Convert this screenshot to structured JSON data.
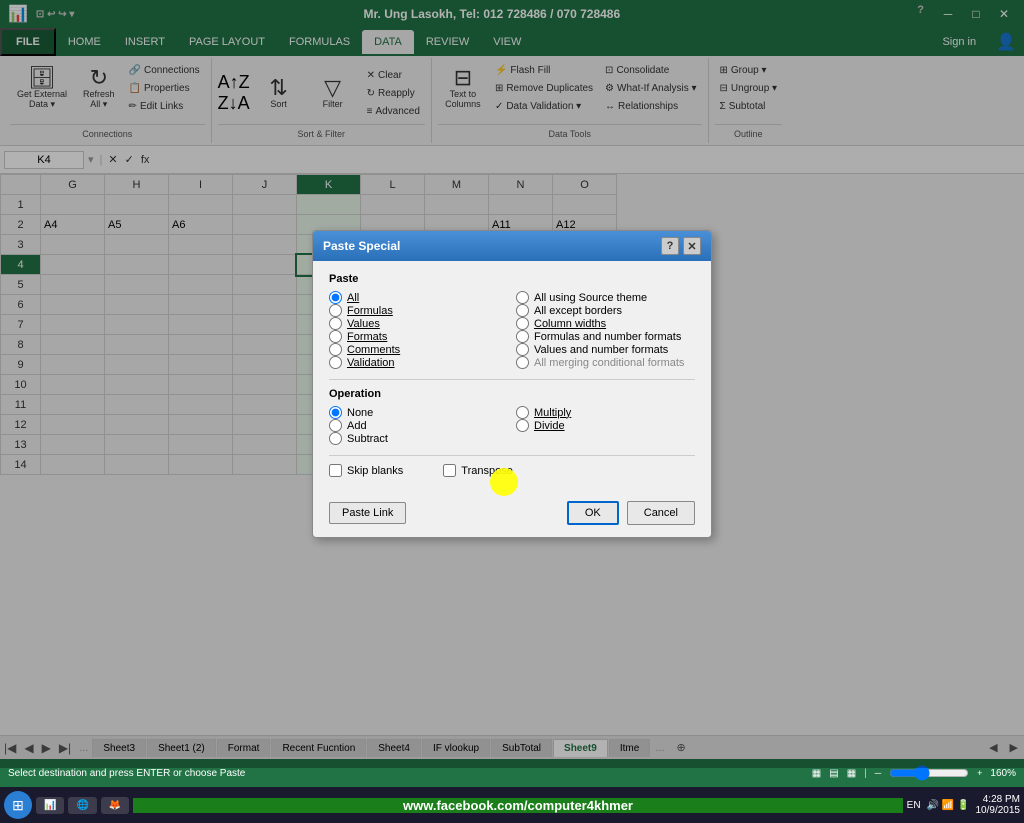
{
  "titleBar": {
    "title": "Mr. Ung Lasokh, Tel: 012 728486 / 070 728486",
    "controls": [
      "?",
      "─",
      "□",
      "✕"
    ]
  },
  "ribbon": {
    "tabs": [
      "FILE",
      "HOME",
      "INSERT",
      "PAGE LAYOUT",
      "FORMULAS",
      "DATA",
      "REVIEW",
      "VIEW"
    ],
    "activeTab": "DATA",
    "signIn": "Sign in",
    "groups": {
      "connections": {
        "label": "Connections",
        "buttons": [
          {
            "icon": "⬇",
            "label": "Get External\nData ▾"
          },
          {
            "icon": "↻",
            "label": "Refresh\nAll ▾"
          }
        ],
        "smallButtons": [
          {
            "icon": "🔗",
            "label": "Connections"
          },
          {
            "icon": "📋",
            "label": "Properties"
          },
          {
            "icon": "✏️",
            "label": "Edit Links"
          }
        ]
      },
      "sortFilter": {
        "label": "Sort & Filter",
        "sortAZ": "A→Z",
        "sortZA": "Z→A",
        "sortLabel": "Sort",
        "filterLabel": "Filter",
        "clearLabel": "Clear",
        "reapplyLabel": "Reapply",
        "advancedLabel": "Advanced"
      },
      "dataTools": {
        "label": "Data Tools",
        "textToColumns": "Text to\nColumns",
        "flashFill": "Flash Fill",
        "removeDuplicates": "Remove Duplicates",
        "dataValidation": "Data Validation ▾",
        "whatIfAnalysis": "What-If Analysis ▾",
        "relationships": "Relationships",
        "consolidate": "Consolidate"
      },
      "outline": {
        "label": "Outline",
        "group": "Group ▾",
        "ungroup": "Ungroup ▾",
        "subtotal": "Subtotal"
      }
    }
  },
  "formulaBar": {
    "nameBox": "K4",
    "formula": ""
  },
  "columns": [
    "",
    "G",
    "H",
    "I",
    "J",
    "K",
    "L",
    "M",
    "N",
    "O"
  ],
  "rows": [
    {
      "num": "1",
      "cells": [
        "",
        "",
        "",
        "",
        "",
        "",
        "",
        "",
        ""
      ]
    },
    {
      "num": "2",
      "cells": [
        "A4",
        "A5",
        "A6",
        "",
        "",
        "",
        "",
        "A11",
        "A12"
      ]
    },
    {
      "num": "3",
      "cells": [
        "",
        "",
        "",
        "",
        "",
        "",
        "",
        "",
        ""
      ]
    },
    {
      "num": "4",
      "cells": [
        "",
        "",
        "",
        "",
        "",
        "",
        "",
        "",
        ""
      ]
    },
    {
      "num": "5",
      "cells": [
        "",
        "",
        "",
        "",
        "",
        "",
        "",
        "",
        ""
      ]
    },
    {
      "num": "6",
      "cells": [
        "",
        "",
        "",
        "",
        "",
        "",
        "",
        "",
        ""
      ]
    },
    {
      "num": "7",
      "cells": [
        "",
        "",
        "",
        "",
        "",
        "",
        "",
        "",
        ""
      ]
    },
    {
      "num": "8",
      "cells": [
        "",
        "",
        "",
        "",
        "",
        "",
        "",
        "",
        ""
      ]
    },
    {
      "num": "9",
      "cells": [
        "",
        "",
        "",
        "",
        "",
        "",
        "",
        "",
        ""
      ]
    },
    {
      "num": "10",
      "cells": [
        "",
        "",
        "",
        "",
        "",
        "",
        "",
        "",
        ""
      ]
    },
    {
      "num": "11",
      "cells": [
        "",
        "",
        "",
        "",
        "",
        "",
        "",
        "",
        ""
      ]
    },
    {
      "num": "12",
      "cells": [
        "",
        "",
        "",
        "",
        "",
        "",
        "",
        "",
        ""
      ]
    },
    {
      "num": "13",
      "cells": [
        "",
        "",
        "",
        "",
        "",
        "",
        "",
        "",
        ""
      ]
    },
    {
      "num": "14",
      "cells": [
        "",
        "",
        "",
        "",
        "",
        "",
        "",
        "",
        ""
      ]
    }
  ],
  "dialog": {
    "title": "Paste Special",
    "pasteSection": "Paste",
    "pasteOptions": [
      {
        "id": "all",
        "label": "All",
        "checked": true
      },
      {
        "id": "formulas",
        "label": "Formulas"
      },
      {
        "id": "values",
        "label": "Values"
      },
      {
        "id": "formats",
        "label": "Formats"
      },
      {
        "id": "comments",
        "label": "Comments"
      },
      {
        "id": "validation",
        "label": "Validation"
      }
    ],
    "pasteOptionsRight": [
      {
        "id": "allUsingSource",
        "label": "All using Source theme"
      },
      {
        "id": "allExceptBorders",
        "label": "All except borders"
      },
      {
        "id": "columnWidths",
        "label": "Column widths"
      },
      {
        "id": "formulasAndNumbers",
        "label": "Formulas and number formats"
      },
      {
        "id": "valuesAndNumbers",
        "label": "Values and number formats"
      },
      {
        "id": "allMerging",
        "label": "All merging conditional formats"
      }
    ],
    "operationSection": "Operation",
    "operationOptions": [
      {
        "id": "none",
        "label": "None",
        "checked": true
      },
      {
        "id": "add",
        "label": "Add"
      },
      {
        "id": "subtract",
        "label": "Subtract"
      }
    ],
    "operationOptionsRight": [
      {
        "id": "multiply",
        "label": "Multiply"
      },
      {
        "id": "divide",
        "label": "Divide"
      }
    ],
    "skipBlanks": "Skip blanks",
    "transpose": "Transpose",
    "pasteLinkBtn": "Paste Link",
    "okBtn": "OK",
    "cancelBtn": "Cancel"
  },
  "sheets": [
    "Sheet3",
    "Sheet1 (2)",
    "Format",
    "Recent Fucntion",
    "Sheet4",
    "IF vlookup",
    "SubTotal",
    "Sheet9",
    "Itme"
  ],
  "activeSheet": "Sheet9",
  "statusBar": {
    "message": "Select destination and press ENTER or choose Paste",
    "viewNormal": "▦",
    "viewPage": "▤",
    "viewBreak": "▦",
    "zoom": "160%"
  },
  "taskbar": {
    "time": "4:28 PM",
    "date": "10/9/2015",
    "website": "www.facebook.com/computer4khmer",
    "language": "EN"
  }
}
